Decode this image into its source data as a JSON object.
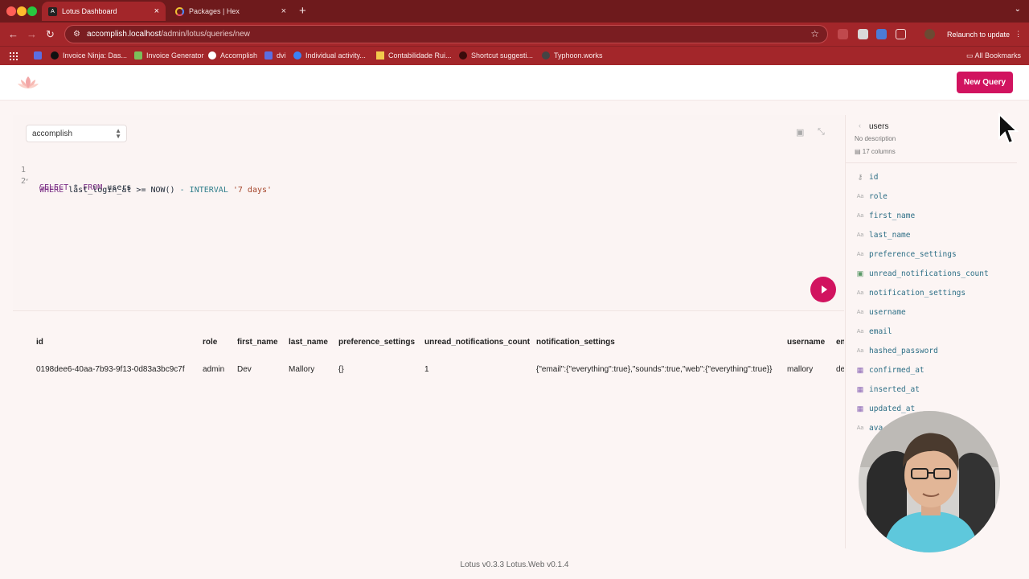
{
  "browser": {
    "tabs": [
      {
        "title": "Lotus Dashboard",
        "close": "×"
      },
      {
        "title": "Packages | Hex",
        "close": "×"
      }
    ],
    "new_tab": "+",
    "tabs_menu": "⌄",
    "back": "←",
    "forward": "→",
    "reload": "↻",
    "url_host": "accomplish.localhost",
    "url_path": "/admin/lotus/queries/new",
    "relaunch_label": "Relaunch to update",
    "bookmarks": [
      "Invoice Ninja: Das...",
      "Invoice Generator",
      "Accomplish",
      "dvi",
      "Individual activity...",
      "Contabilidade Rui...",
      "Shortcut suggesti...",
      "Typhoon.works"
    ],
    "all_bookmarks": "All Bookmarks"
  },
  "header": {
    "new_query_label": "New Query"
  },
  "editor": {
    "database": "accomplish",
    "lines": [
      {
        "n": "1",
        "fold": "⌄"
      },
      {
        "n": "2",
        "fold": ""
      }
    ],
    "line1": {
      "kw1": "SELECT",
      "rest": " * ",
      "kw2": "FROM",
      "table": " users"
    },
    "line2": {
      "kw1": "WHERE",
      "col": " last_login_at >= NOW() ",
      "op": "-",
      "sp": " ",
      "kw2": "INTERVAL",
      "str": " '7 days'"
    }
  },
  "results": {
    "columns": [
      "id",
      "role",
      "first_name",
      "last_name",
      "preference_settings",
      "unread_notifications_count",
      "notification_settings",
      "username",
      "en"
    ],
    "rows": [
      [
        "0198dee6-40aa-7b93-9f13-0d83a3bc9c7f",
        "admin",
        "Dev",
        "Mallory",
        "{}",
        "1",
        "{\"email\":{\"everything\":true},\"sounds\":true,\"web\":{\"everything\":true}}",
        "mallory",
        "de"
      ]
    ]
  },
  "sidebar": {
    "table_name": "users",
    "description": "No description",
    "column_count": "17 columns",
    "columns": [
      {
        "name": "id",
        "icon": "key-icon"
      },
      {
        "name": "role",
        "icon": "text-type-icon"
      },
      {
        "name": "first_name",
        "icon": "text-type-icon"
      },
      {
        "name": "last_name",
        "icon": "text-type-icon"
      },
      {
        "name": "preference_settings",
        "icon": "text-type-icon"
      },
      {
        "name": "unread_notifications_count",
        "icon": "number-type-icon"
      },
      {
        "name": "notification_settings",
        "icon": "text-type-icon"
      },
      {
        "name": "username",
        "icon": "text-type-icon"
      },
      {
        "name": "email",
        "icon": "text-type-icon"
      },
      {
        "name": "hashed_password",
        "icon": "text-type-icon"
      },
      {
        "name": "confirmed_at",
        "icon": "date-type-icon"
      },
      {
        "name": "inserted_at",
        "icon": "date-type-icon"
      },
      {
        "name": "updated_at",
        "icon": "date-type-icon"
      },
      {
        "name": "ava",
        "icon": "text-type-icon"
      }
    ]
  },
  "footer": {
    "text": "Lotus v0.3.3   Lotus.Web v0.1.4"
  },
  "colors": {
    "chrome": "#a3262a",
    "accent": "#d1135f",
    "column_text": "#2e6f86"
  }
}
